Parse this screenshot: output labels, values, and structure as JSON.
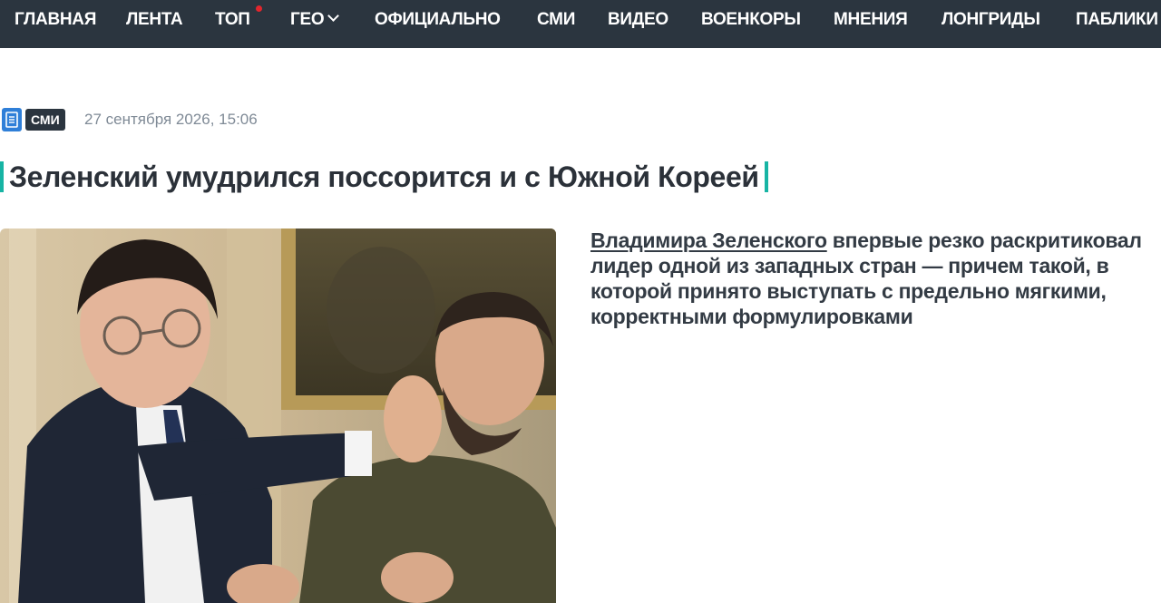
{
  "nav": {
    "items": [
      "ГЛАВНАЯ",
      "ЛЕНТА",
      "ТОП",
      "ГЕО",
      "ОФИЦИАЛЬНО",
      "СМИ",
      "ВИДЕО",
      "ВОЕНКОРЫ",
      "МНЕНИЯ",
      "ЛОНГРИДЫ",
      "ПАБЛИКИ"
    ],
    "top_indicator_color": "#e3262d",
    "background": "#2b353f"
  },
  "article": {
    "source_badge": "СМИ",
    "source_icon": "document-icon",
    "date": "27 сентября 2026, 15:06",
    "title": "Зеленский умудрился поссорится и с Южной Кореей",
    "accent_color": "#17b4a4",
    "lead_link": "Владимира Зеленского",
    "lead_rest": " впервые резко раскритиковал лидер одной из западных стран — причем такой, в которой принято выступать с предельно мягкими, корректными формулировками"
  }
}
